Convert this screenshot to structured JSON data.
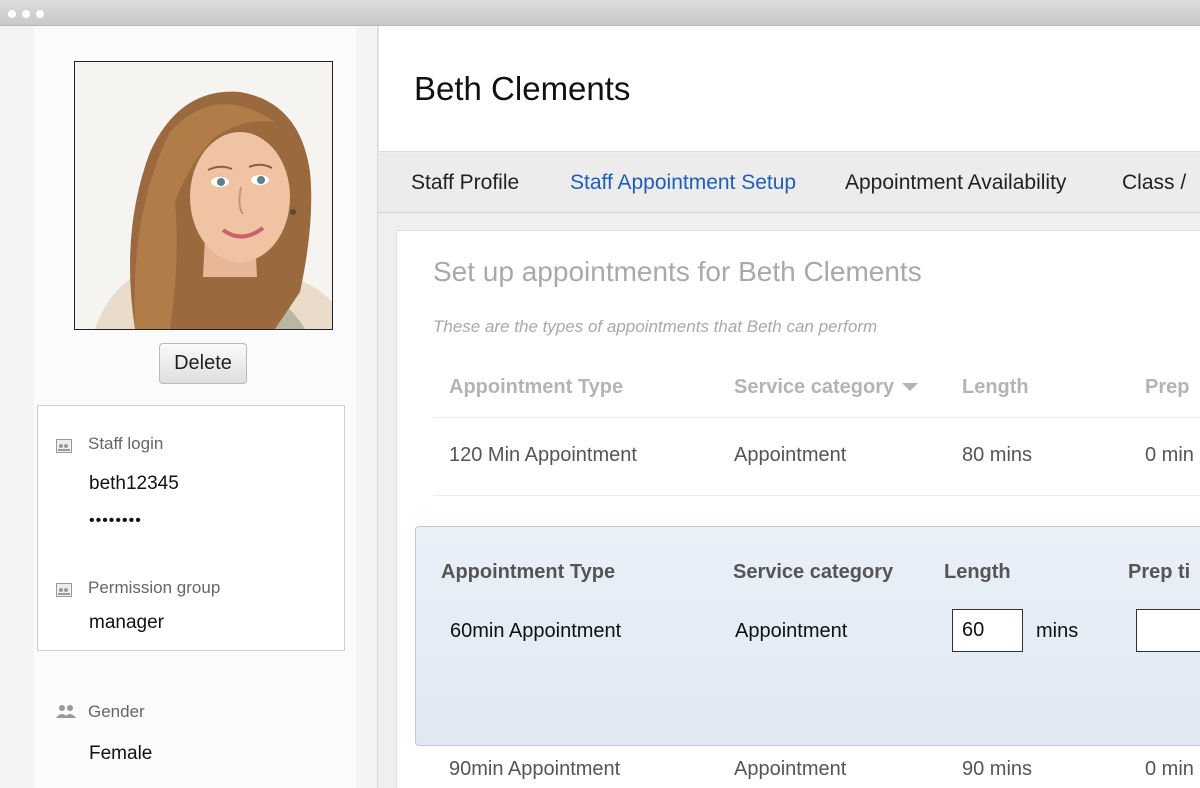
{
  "staff": {
    "name": "Beth Clements",
    "delete_label": "Delete",
    "login_label": "Staff login",
    "username": "beth12345",
    "password_mask": "••••••••",
    "permission_label": "Permission group",
    "permission_value": "manager",
    "gender_label": "Gender",
    "gender_value": "Female"
  },
  "tabs": [
    {
      "label": "Staff Profile",
      "active": false
    },
    {
      "label": "Staff Appointment Setup",
      "active": true
    },
    {
      "label": "Appointment Availability",
      "active": false
    },
    {
      "label": "Class /",
      "active": false
    }
  ],
  "section": {
    "title": "Set up appointments for Beth Clements",
    "subtitle": "These are the types of appointments that Beth can perform"
  },
  "table": {
    "headers": [
      "Appointment Type",
      "Service category",
      "Length",
      "Prep"
    ],
    "rows": [
      [
        "120 Min Appointment",
        "Appointment",
        "80 mins",
        "0 min"
      ],
      [
        "90min Appointment",
        "Appointment",
        "90 mins",
        "0 min"
      ]
    ]
  },
  "editor": {
    "headers": [
      "Appointment Type",
      "Service category",
      "Length",
      "Prep ti"
    ],
    "type": "60min Appointment",
    "category": "Appointment",
    "length_value": "60",
    "length_unit": "mins",
    "prep_value": ""
  },
  "colors": {
    "active_tab": "#1f5eb8",
    "panel_bg": "#e3ebf5"
  }
}
